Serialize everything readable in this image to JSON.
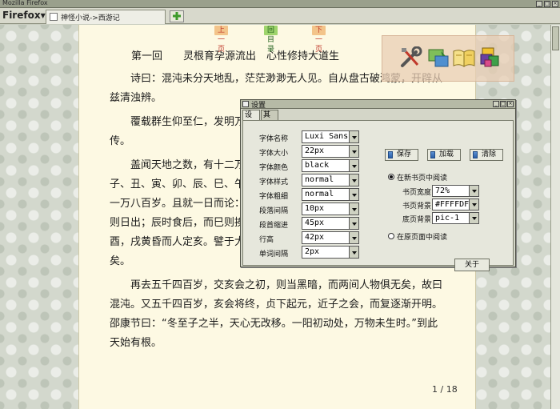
{
  "window": {
    "title": "Mozilla Firefox",
    "buttons": [
      "_",
      "□",
      "×"
    ]
  },
  "browser": {
    "menu_label": "Firefox",
    "tab_title": "神怪小说->西游记",
    "new_tab_icon": "plus-icon"
  },
  "reader": {
    "nav": {
      "prev": "上一页",
      "toc": "回目录",
      "next": "下一页"
    },
    "chapter_title": "第一回　　灵根育孕源流出　心性修持大道生",
    "paragraphs": [
      "诗曰：混沌未分天地乱，茫茫渺渺无人见。自从盘古破鸿蒙，开辟从兹清浊辨。",
      "覆载群生仰至仁，发明万物皆成善。欲知造化会元功，须看西游释厄传。",
      "盖闻天地之数，有十二万九千六百岁为一元。将一元分为十二会，乃子、丑、寅、卯、辰、巳、午、未、申、酉、戌、亥之十二支也。每会该一万八百岁。且就一日而论：子时得阳气，而丑则鸡鸣；寅不通光，而卯则日出；辰时食后，而巳则挨排；日午天中，而未则西蹉；申时晡而日落酉，戌黄昏而人定亥。譬于大数，若到戌会之终，则天地昏蒙而万物否矣。",
      "再去五千四百岁，交亥会之初，则当黑暗，而两间人物俱无矣，故曰混沌。又五千四百岁，亥会将终，贞下起元，近子之会，而复逐渐开明。邵康节曰：“冬至子之半，天心无改移。一阳初动处，万物未生时。”到此天始有根。"
    ],
    "page_indicator": "1 / 18"
  },
  "tool_panel": {
    "icons": [
      "wrench-screwdriver-icon",
      "layout-pane-icon",
      "open-book-icon",
      "color-blocks-icon"
    ]
  },
  "settings_dialog": {
    "title": "设置",
    "tabs": [
      "设置",
      "其它"
    ],
    "fields": [
      {
        "label": "字体名称",
        "value": "Luxi Sans"
      },
      {
        "label": "字体大小",
        "value": "22px"
      },
      {
        "label": "字体颜色",
        "value": "black"
      },
      {
        "label": "字体样式",
        "value": "normal"
      },
      {
        "label": "字体粗细",
        "value": "normal"
      },
      {
        "label": "段落间隔",
        "value": "10px"
      },
      {
        "label": "段首缩进",
        "value": "45px"
      },
      {
        "label": "行高",
        "value": "42px"
      },
      {
        "label": "单词间隔",
        "value": "2px"
      }
    ],
    "actions": {
      "save": "保存",
      "load": "加载",
      "clear": "清除"
    },
    "mode_new_page": {
      "label": "在新书页中阅读",
      "selected": true,
      "fields": [
        {
          "label": "书页宽度",
          "value": "72%"
        },
        {
          "label": "书页背景",
          "value": "#FFFFDF"
        },
        {
          "label": "底页背景",
          "value": "pic-1"
        }
      ]
    },
    "mode_original_page": {
      "label": "在原页面中阅读",
      "selected": false
    },
    "close_label": "关于"
  },
  "colors": {
    "page_background": "#fdf9e3",
    "nav_prev_next": "#f3c48a",
    "nav_toc": "#9ed46b"
  }
}
